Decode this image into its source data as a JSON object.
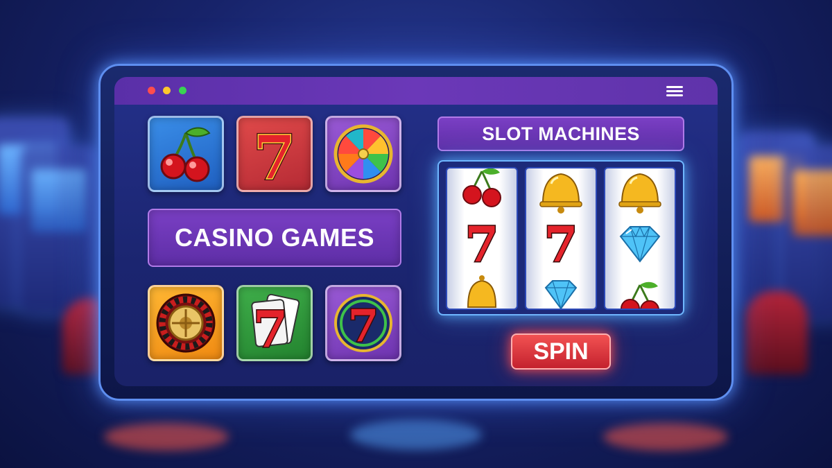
{
  "background": {
    "description_icons": [
      "slot-machine-icon",
      "stool-icon"
    ]
  },
  "window": {
    "controls": [
      "close-dot",
      "minimize-dot",
      "maximize-dot"
    ],
    "menu_icon": "hamburger-menu-icon"
  },
  "game_tiles_top": [
    {
      "icon": "cherry-icon",
      "color": "#2f7de0"
    },
    {
      "icon": "lucky-seven-icon",
      "color": "#d43d42"
    },
    {
      "icon": "prize-wheel-icon",
      "color": "#8a48c8"
    }
  ],
  "banner": {
    "label": "CASINO GAMES"
  },
  "game_tiles_bottom": [
    {
      "icon": "roulette-icon",
      "color": "#f9a423"
    },
    {
      "icon": "blackjack-cards-icon",
      "color": "#34a142"
    },
    {
      "icon": "seven-chip-icon",
      "color": "#8a48c8"
    }
  ],
  "slot_machine": {
    "title": "SLOT MACHINES",
    "reels": [
      [
        "cherry",
        "seven",
        "bell"
      ],
      [
        "bell",
        "seven",
        "diamond"
      ],
      [
        "bell",
        "diamond",
        "cherry"
      ]
    ],
    "spin_label": "SPIN"
  },
  "colors": {
    "accent_purple": "#6b38b8",
    "spin_red": "#e23a44",
    "glow_blue": "#6fb7ff",
    "background_navy": "#17236a"
  }
}
